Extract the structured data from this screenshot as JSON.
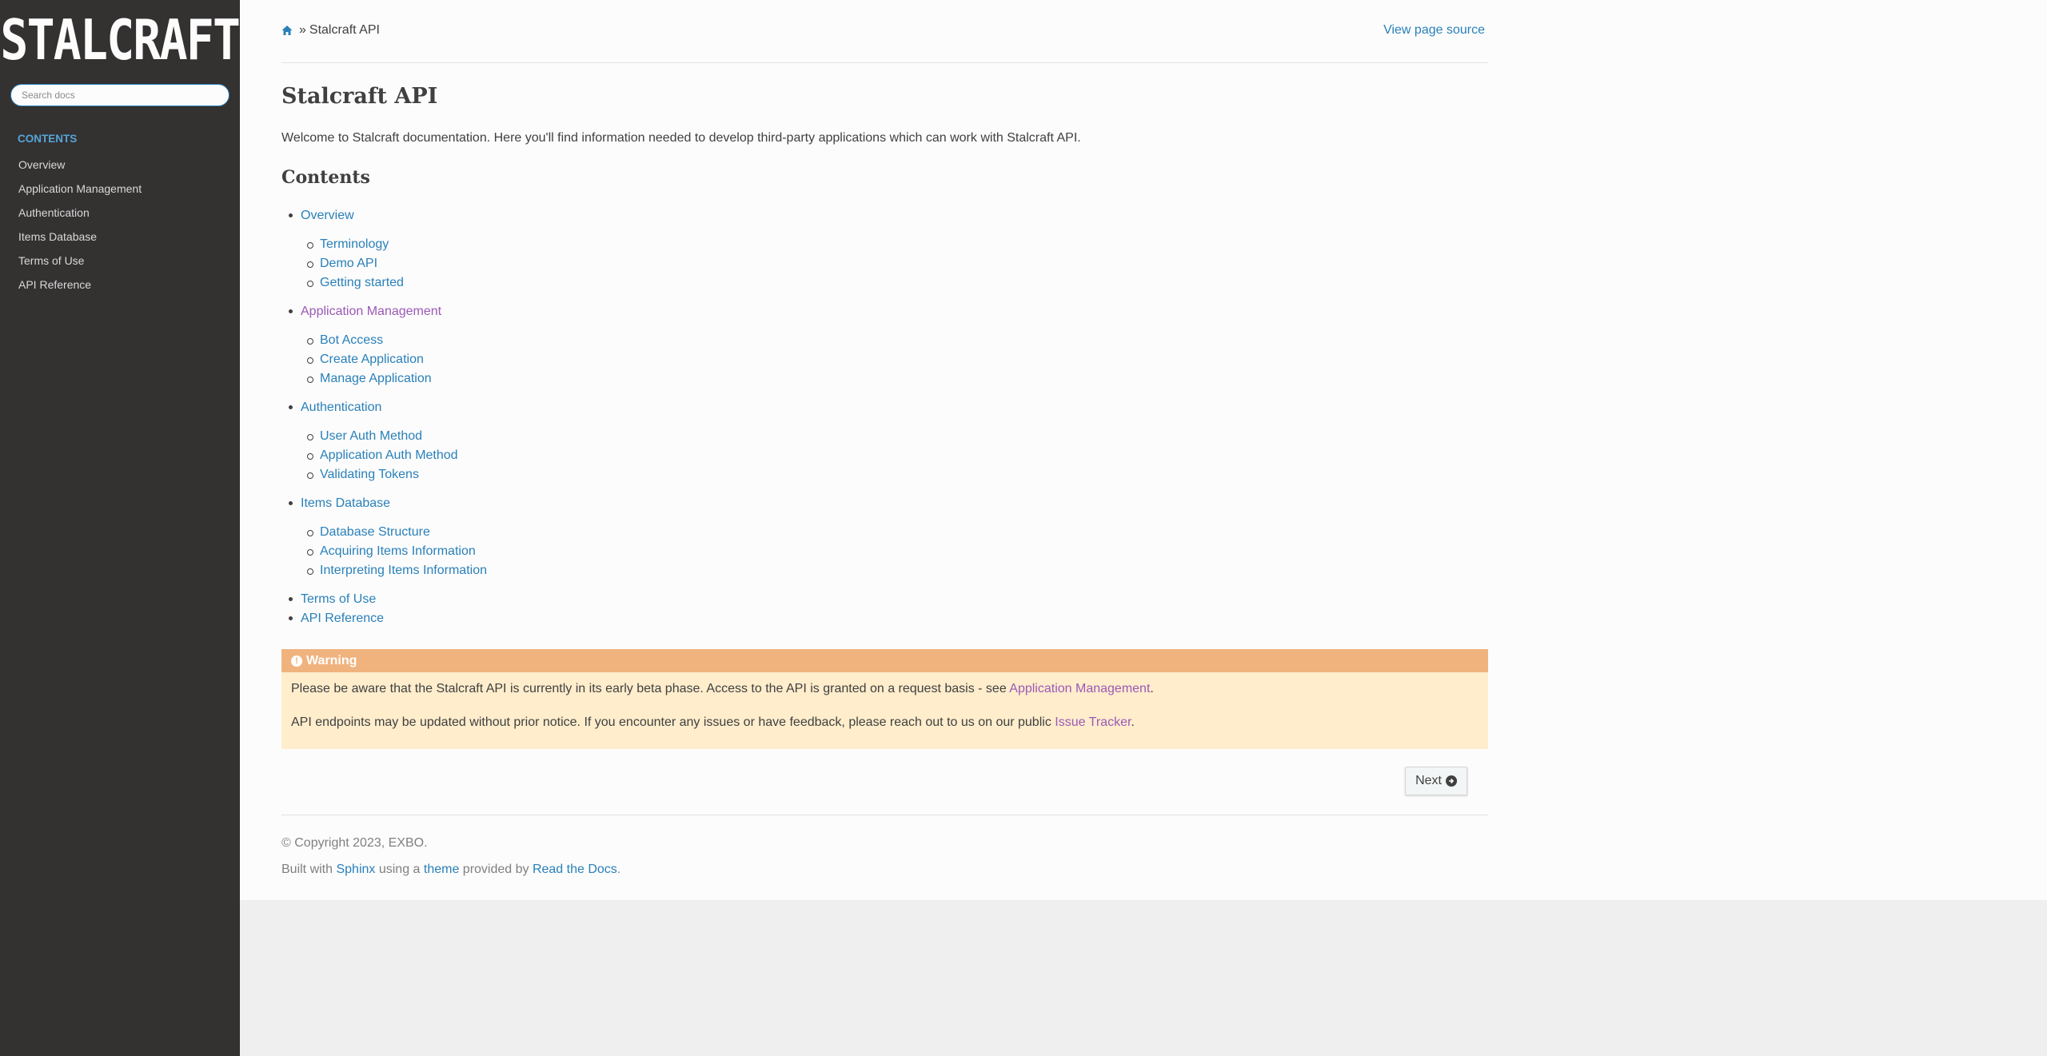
{
  "sidebar": {
    "logo_text": "STALCRAFT",
    "search_placeholder": "Search docs",
    "caption": "CONTENTS",
    "items": [
      {
        "label": "Overview"
      },
      {
        "label": "Application Management"
      },
      {
        "label": "Authentication"
      },
      {
        "label": "Items Database"
      },
      {
        "label": "Terms of Use"
      },
      {
        "label": "API Reference"
      }
    ]
  },
  "header": {
    "home_icon": "home-icon",
    "separator": "»",
    "current": "Stalcraft API",
    "view_source": "View page source"
  },
  "main": {
    "title": "Stalcraft API",
    "intro": "Welcome to Stalcraft documentation. Here you'll find information needed to develop third-party applications which can work with Stalcraft API.",
    "contents_title": "Contents",
    "toc": [
      {
        "label": "Overview",
        "children": [
          "Terminology",
          "Demo API",
          "Getting started"
        ]
      },
      {
        "label": "Application Management",
        "visited": true,
        "children": [
          "Bot Access",
          "Create Application",
          "Manage Application"
        ]
      },
      {
        "label": "Authentication",
        "children": [
          "User Auth Method",
          "Application Auth Method",
          "Validating Tokens"
        ]
      },
      {
        "label": "Items Database",
        "children": [
          "Database Structure",
          "Acquiring Items Information",
          "Interpreting Items Information"
        ]
      },
      {
        "label": "Terms of Use",
        "children": []
      },
      {
        "label": "API Reference",
        "children": []
      }
    ],
    "warning": {
      "icon": "exclamation-circle-icon",
      "title": "Warning",
      "p1_text": "Please be aware that the Stalcraft API is currently in its early beta phase. Access to the API is granted on a request basis - see ",
      "p1_link": "Application Management",
      "p1_end": ".",
      "p2_text": "API endpoints may be updated without prior notice. If you encounter any issues or have feedback, please reach out to us on our public ",
      "p2_link": "Issue Tracker",
      "p2_end": "."
    },
    "next_button": "Next",
    "next_icon": "arrow-circle-right-icon"
  },
  "footer": {
    "copyright": "© Copyright 2023, EXBO.",
    "built_prefix": "Built with ",
    "sphinx": "Sphinx",
    "using": " using a ",
    "theme": "theme",
    "provided": " provided by ",
    "rtd": "Read the Docs",
    "end": "."
  },
  "colors": {
    "sidebar_bg": "#343131",
    "link": "#2980b9",
    "visited_link": "#9b59b6",
    "caption": "#55a5d9",
    "warning_title_bg": "#f0b37e",
    "warning_bg": "#ffedcc"
  }
}
